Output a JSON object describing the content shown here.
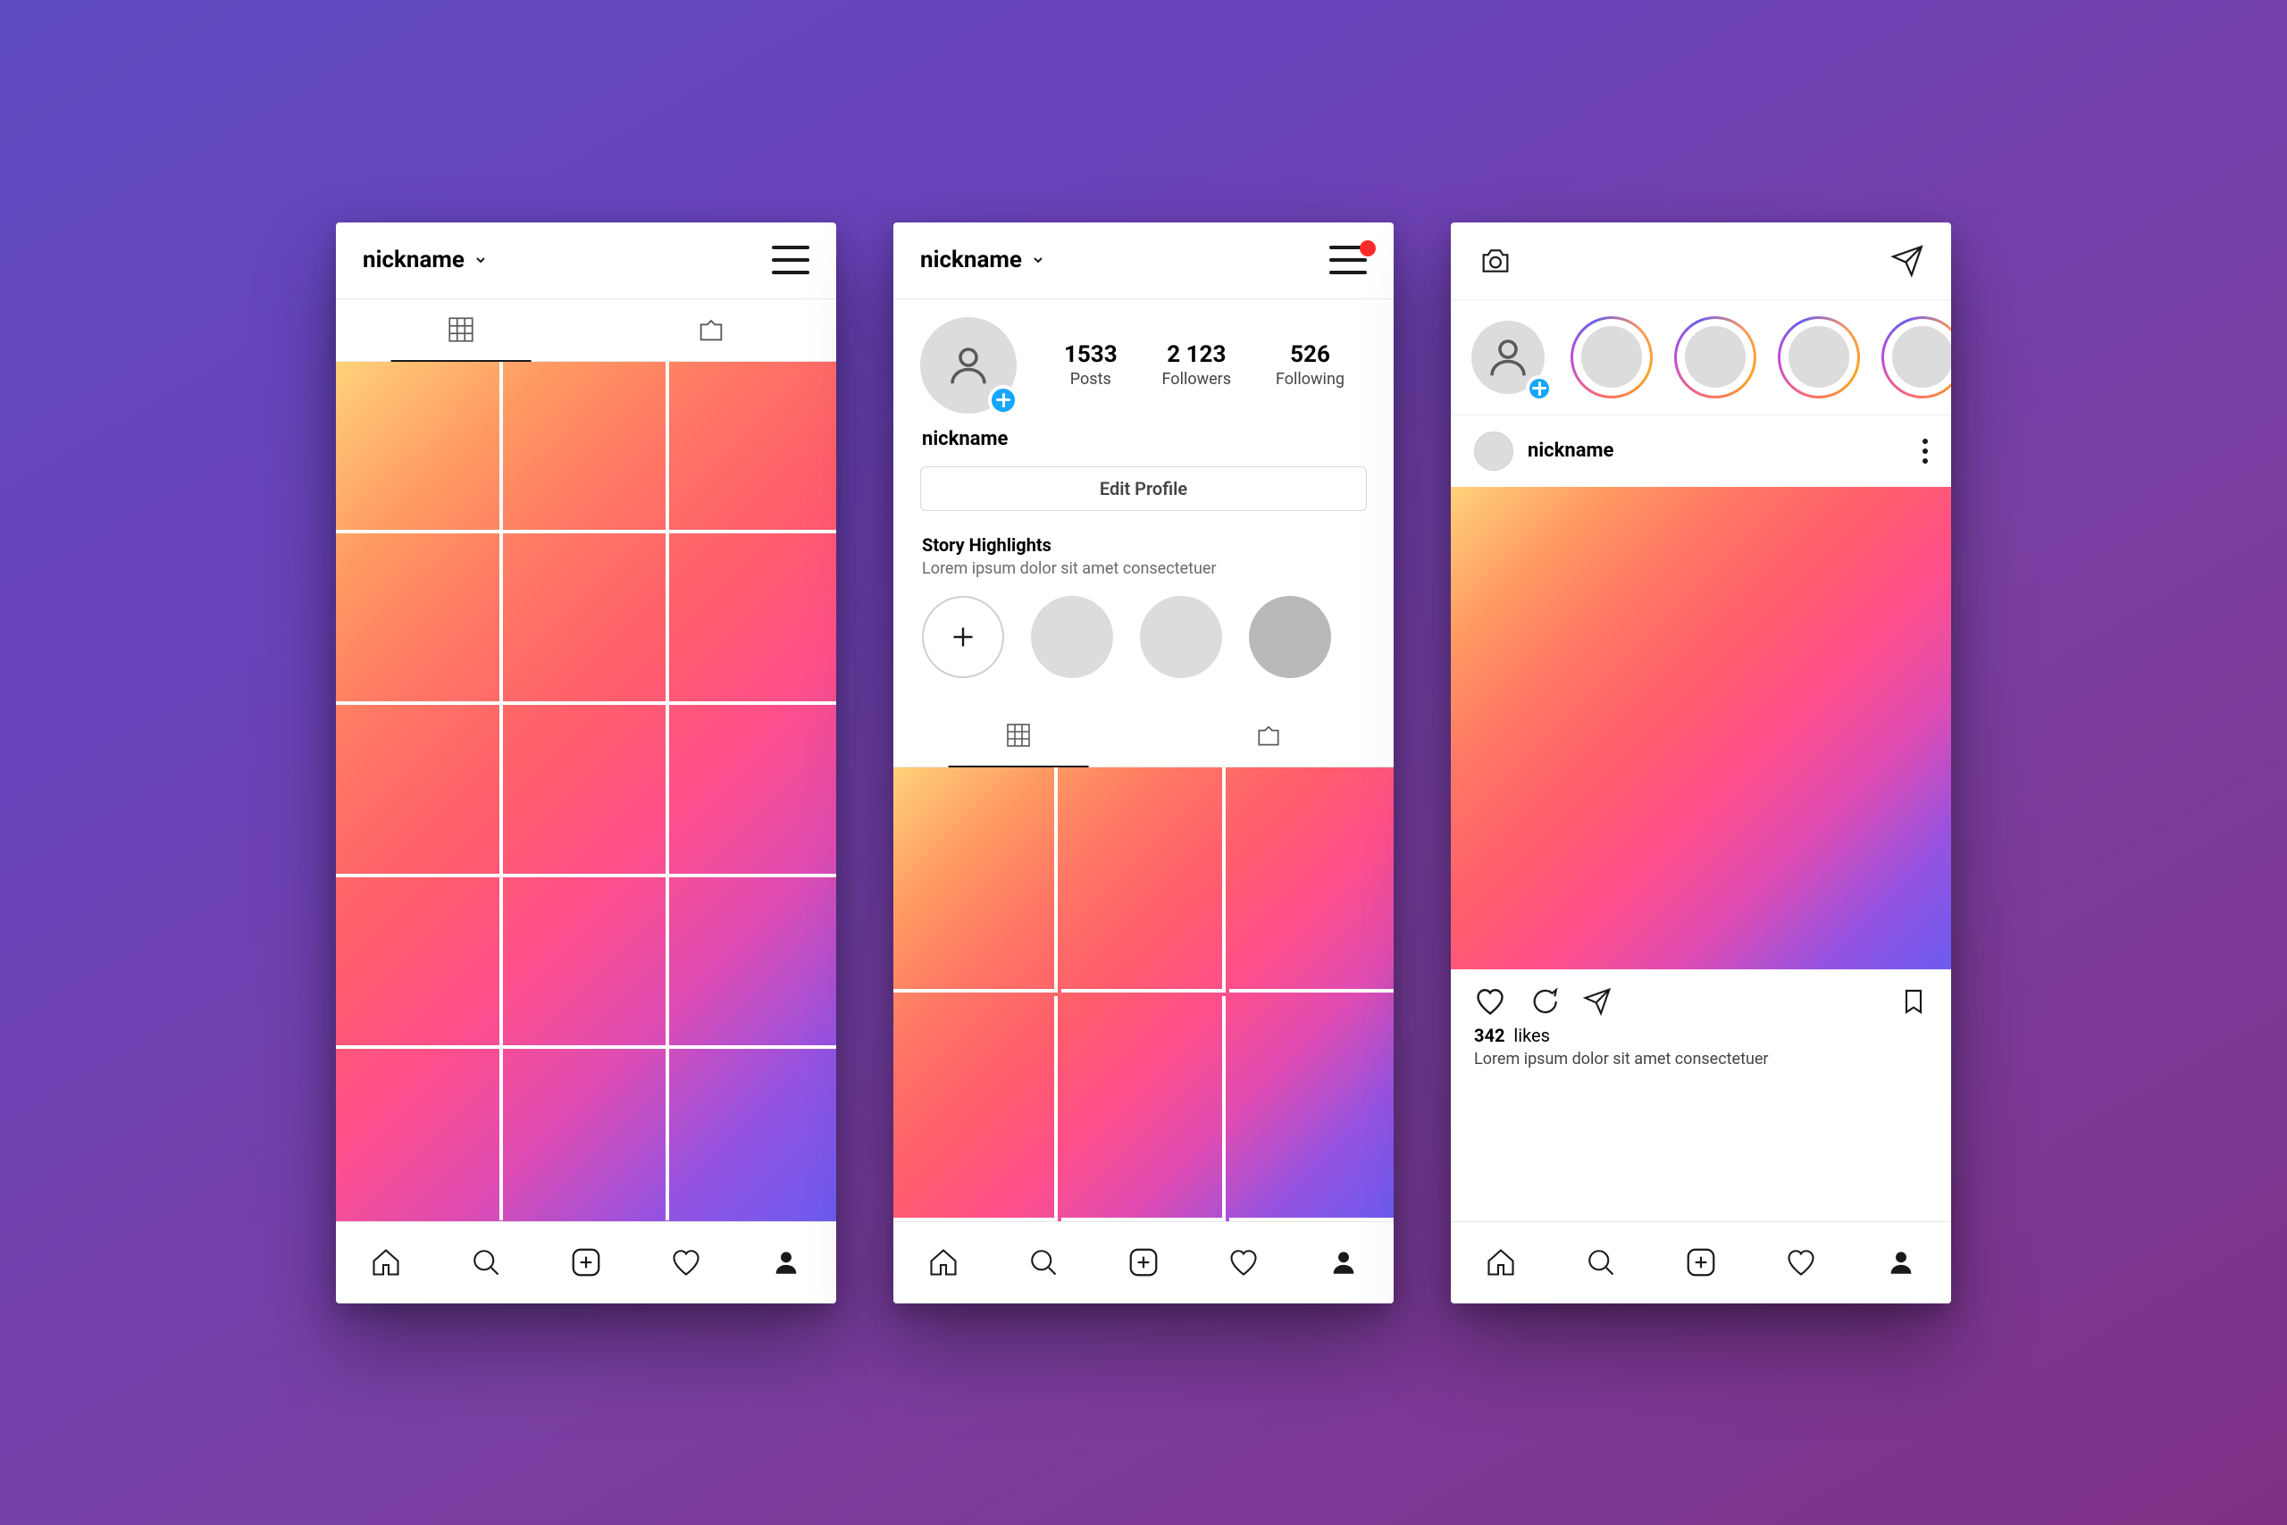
{
  "colors": {
    "accent_blue": "#17a6ff",
    "notification_red": "#ff2b2b"
  },
  "screen_grid": {
    "nickname": "nickname",
    "tabs": {
      "grid_active": true
    }
  },
  "screen_profile": {
    "nickname": "nickname",
    "username": "nickname",
    "has_notification": true,
    "stats": {
      "posts": {
        "value": "1533",
        "label": "Posts"
      },
      "followers": {
        "value": "2 123",
        "label": "Followers"
      },
      "following": {
        "value": "526",
        "label": "Following"
      }
    },
    "edit_button": "Edit Profile",
    "highlights": {
      "title": "Story Highlights",
      "subtitle": "Lorem ipsum dolor sit amet consectetuer"
    }
  },
  "screen_feed": {
    "post": {
      "username": "nickname",
      "likes_count": "342",
      "likes_word": "likes",
      "caption": "Lorem ipsum dolor sit amet consectetuer"
    }
  },
  "bottom_nav": {
    "items": [
      "home",
      "search",
      "add",
      "activity",
      "profile"
    ],
    "active": "profile"
  }
}
